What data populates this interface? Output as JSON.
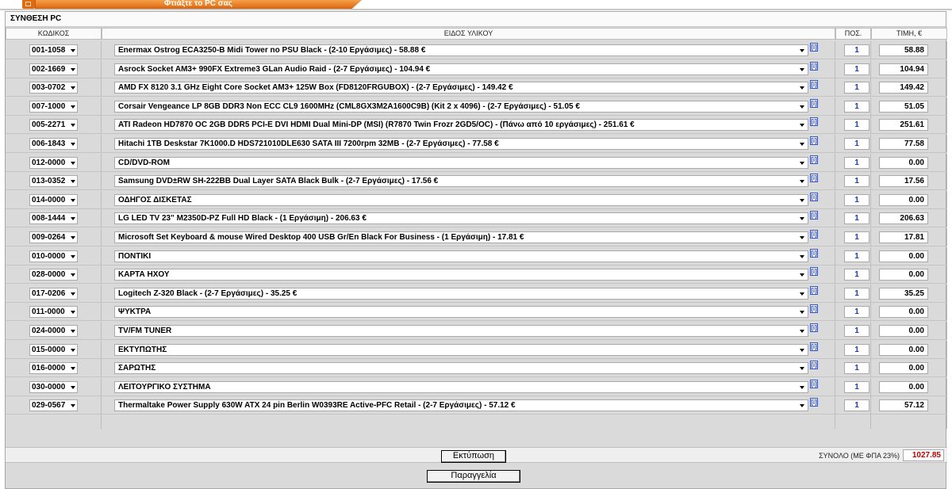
{
  "tab": {
    "label": "Φτιάξτε το PC σας"
  },
  "section_title": "ΣΥΝΘΕΣΗ PC",
  "columns": {
    "code": "ΚΩΔΙΚΟΣ",
    "item": "ΕΙΔΟΣ ΥΛΙΚΟΥ",
    "qty": "ΠΟΣ.",
    "price": "ΤΙΜΗ, €"
  },
  "info_label": "[i]",
  "rows": [
    {
      "code": "001-1058",
      "item": "Enermax Ostrog ECA3250-B Midi Tower no PSU Black - (2-10 Εργάσιμες) - 58.88 €",
      "qty": "1",
      "price": "58.88"
    },
    {
      "code": "002-1669",
      "item": "Asrock Socket AM3+ 990FX Extreme3 GLan Audio Raid - (2-7 Εργάσιμες) - 104.94 €",
      "qty": "1",
      "price": "104.94"
    },
    {
      "code": "003-0702",
      "item": "AMD FX 8120 3.1 GHz Eight Core Socket AM3+ 125W Box (FD8120FRGUBOX) - (2-7 Εργάσιμες) - 149.42 €",
      "qty": "1",
      "price": "149.42"
    },
    {
      "code": "007-1000",
      "item": "Corsair Vengeance LP 8GB DDR3 Non ECC CL9 1600MHz (CML8GX3M2A1600C9B) (Kit 2 x 4096) - (2-7 Εργάσιμες) - 51.05 €",
      "qty": "1",
      "price": "51.05"
    },
    {
      "code": "005-2271",
      "item": "ATI Radeon HD7870 OC 2GB DDR5 PCI-E DVI HDMI Dual Mini-DP (MSI) (R7870 Twin Frozr 2GD5/OC) - (Πάνω από 10 εργάσιμες) - 251.61 €",
      "qty": "1",
      "price": "251.61"
    },
    {
      "code": "006-1843",
      "item": "Hitachi 1TB Deskstar 7K1000.D HDS721010DLE630 SATA III 7200rpm 32MB - (2-7 Εργάσιμες) - 77.58 €",
      "qty": "1",
      "price": "77.58"
    },
    {
      "code": "012-0000",
      "item": "CD/DVD-ROM",
      "qty": "1",
      "price": "0.00"
    },
    {
      "code": "013-0352",
      "item": "Samsung DVD±RW SH-222BB Dual Layer SATA Black Bulk - (2-7 Εργάσιμες) - 17.56 €",
      "qty": "1",
      "price": "17.56"
    },
    {
      "code": "014-0000",
      "item": "ΟΔΗΓΟΣ ΔΙΣΚΕΤΑΣ",
      "qty": "1",
      "price": "0.00"
    },
    {
      "code": "008-1444",
      "item": "LG LED TV 23\" M2350D-PZ Full HD Black - (1 Εργάσιμη) - 206.63 €",
      "qty": "1",
      "price": "206.63"
    },
    {
      "code": "009-0264",
      "item": "Microsoft Set Keyboard & mouse Wired Desktop 400 USB Gr/En Black For Business - (1 Εργάσιμη) - 17.81 €",
      "qty": "1",
      "price": "17.81"
    },
    {
      "code": "010-0000",
      "item": "ΠΟΝΤΙΚΙ",
      "qty": "1",
      "price": "0.00"
    },
    {
      "code": "028-0000",
      "item": "ΚΑΡΤΑ ΗΧΟΥ",
      "qty": "1",
      "price": "0.00"
    },
    {
      "code": "017-0206",
      "item": "Logitech Z-320 Black - (2-7 Εργάσιμες) - 35.25 €",
      "qty": "1",
      "price": "35.25"
    },
    {
      "code": "011-0000",
      "item": "ΨΥΚΤΡΑ",
      "qty": "1",
      "price": "0.00"
    },
    {
      "code": "024-0000",
      "item": "TV/FM TUNER",
      "qty": "1",
      "price": "0.00"
    },
    {
      "code": "015-0000",
      "item": "ΕΚΤΥΠΩΤΗΣ",
      "qty": "1",
      "price": "0.00"
    },
    {
      "code": "016-0000",
      "item": "ΣΑΡΩΤΗΣ",
      "qty": "1",
      "price": "0.00"
    },
    {
      "code": "030-0000",
      "item": "ΛΕΙΤΟΥΡΓΙΚΟ ΣΥΣΤΗΜΑ",
      "qty": "1",
      "price": "0.00"
    },
    {
      "code": "029-0567",
      "item": "Thermaltake Power Supply 630W ATX 24 pin Berlin W0393RE Active-PFC Retail - (2-7 Εργάσιμες) - 57.12 €",
      "qty": "1",
      "price": "57.12"
    }
  ],
  "total": {
    "label": "ΣΥΝΟΛΟ (ΜΕ ΦΠΑ 23%)",
    "value": "1027.85"
  },
  "buttons": {
    "print": "Εκτύπωση",
    "order": "Παραγγελία"
  },
  "colors": {
    "tab": "#e26b12",
    "total": "#c00000",
    "qty": "#1a3fb8"
  }
}
